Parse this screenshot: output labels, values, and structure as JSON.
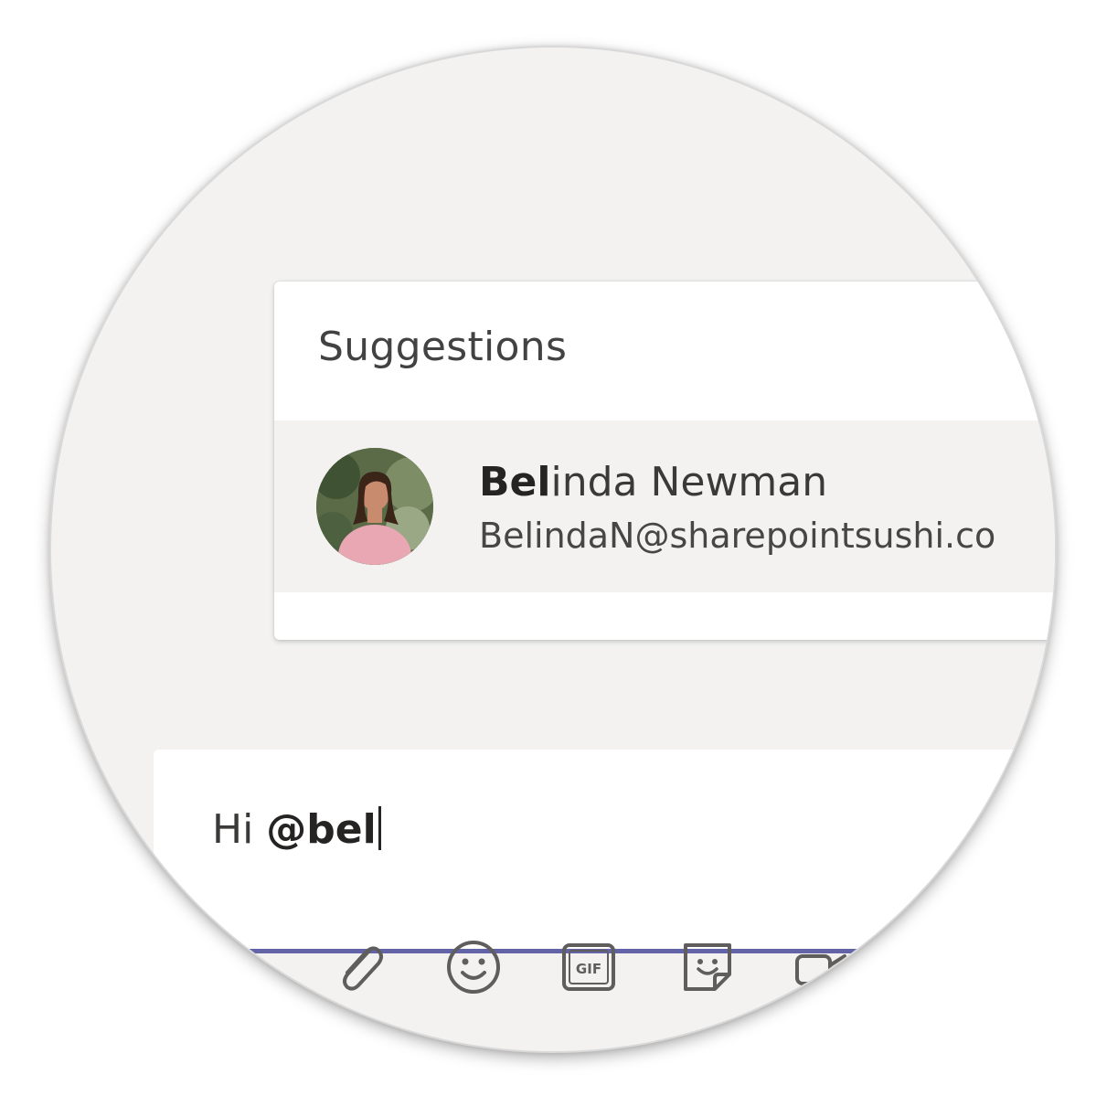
{
  "suggestions": {
    "title": "Suggestions",
    "items": [
      {
        "name_match": "Bel",
        "name_rest": "inda Newman",
        "email": "BelindaN@sharepointsushi.co"
      }
    ]
  },
  "compose": {
    "prefix": "Hi ",
    "mention": "@bel"
  },
  "toolbar": {
    "icons": [
      "attach-icon",
      "emoji-icon",
      "gif-icon",
      "sticker-icon",
      "meet-now-icon"
    ]
  },
  "colors": {
    "accent": "#6264a7",
    "panel_bg": "#f3f2f1"
  }
}
